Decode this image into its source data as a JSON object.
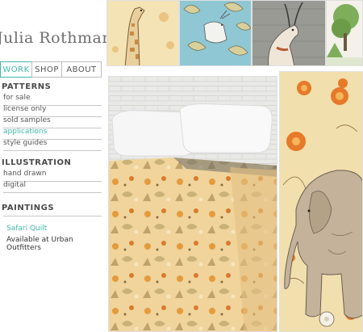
{
  "site": {
    "title": "Julia Rothman"
  },
  "nav": {
    "work": "WORK",
    "shop": "SHOP",
    "about": "ABOUT"
  },
  "sections": {
    "patterns": {
      "heading": "PATTERNS",
      "items": [
        "for sale",
        "license only",
        "sold samples",
        "applications",
        "style guides"
      ]
    },
    "illustration": {
      "heading": "ILLUSTRATION",
      "items": [
        "hand drawn",
        "digital"
      ]
    },
    "paintings": {
      "heading": "PAINTINGS"
    }
  },
  "caption": {
    "title": "Safari Quilt",
    "subtitle": "Available at Urban Outfitters"
  },
  "colors": {
    "accent": "#3fb8a8",
    "text": "#4a4a4a",
    "rule": "#c7c7c7"
  }
}
